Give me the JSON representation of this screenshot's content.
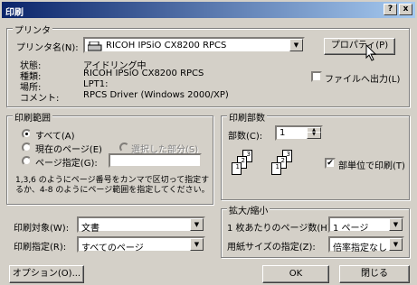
{
  "window": {
    "title": "印刷",
    "help_label": "?",
    "close_label": "x"
  },
  "printer": {
    "group_label": "プリンタ",
    "name_label": "プリンタ名(N):",
    "name_value": "RICOH IPSiO CX8200 RPCS",
    "properties_label": "プロパティ(P)",
    "status_label": "状態:",
    "status_value": "アイドリング中",
    "type_label": "種類:",
    "type_value": "RICOH IPSiO CX8200 RPCS",
    "location_label": "場所:",
    "location_value": "LPT1:",
    "comment_label": "コメント:",
    "comment_value": "RPCS Driver (Windows 2000/XP)",
    "print_to_file_label": "ファイルへ出力(L)",
    "print_to_file_checked": false
  },
  "range": {
    "group_label": "印刷範囲",
    "all_label": "すべて(A)",
    "current_label": "現在のページ(E)",
    "selection_label": "選択した部分(S)",
    "pages_label": "ページ指定(G):",
    "pages_value": "",
    "selected": "all",
    "hint": "1,3,6 のようにページ番号をカンマで区切って指定するか、4-8 のようにページ範囲を指定してください。",
    "hint_line1": "1,3,6 のようにページ番号をカンマで区切って指定す",
    "hint_line2": "るか、4-8 のようにページ範囲を指定してください。"
  },
  "copies": {
    "group_label": "印刷部数",
    "count_label": "部数(C):",
    "count_value": "1",
    "collate_label": "部単位で印刷(T)",
    "collate_checked": true
  },
  "options_left": {
    "print_what_label": "印刷対象(W):",
    "print_what_value": "文書",
    "print_label": "印刷指定(R):",
    "print_value": "すべてのページ"
  },
  "zoom": {
    "group_label": "拡大/縮小",
    "pages_per_sheet_label": "1 枚あたりのページ数(H):",
    "pages_per_sheet_value": "1 ページ",
    "scale_label": "用紙サイズの指定(Z):",
    "scale_value": "倍率指定なし"
  },
  "buttons": {
    "options_label": "オプション(O)...",
    "ok_label": "OK",
    "close_label": "閉じる"
  }
}
